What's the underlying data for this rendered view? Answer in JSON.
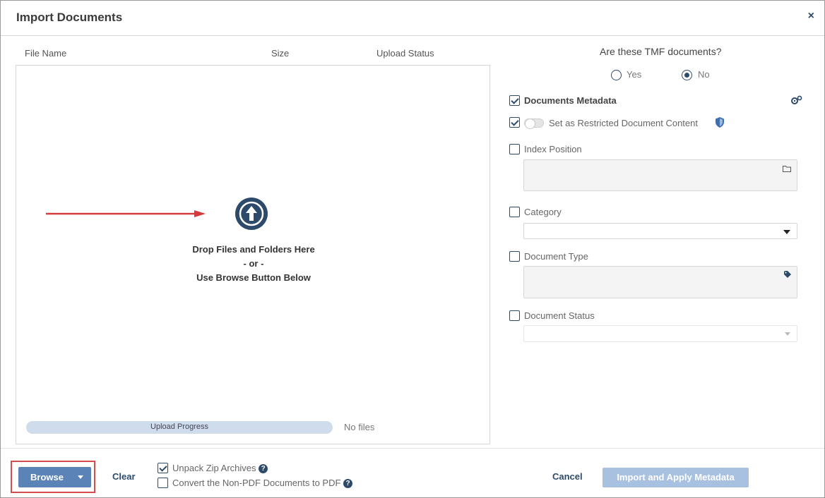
{
  "dialog": {
    "title": "Import Documents",
    "close_label": "×"
  },
  "file_table": {
    "columns": [
      "File Name",
      "Size",
      "Upload Status"
    ]
  },
  "dropzone": {
    "line1": "Drop Files and Folders Here",
    "line2": "- or -",
    "line3": "Use Browse Button Below",
    "upload_icon": "upload-arrow-circle",
    "pointer_arrow_color": "#d63a3a"
  },
  "progress": {
    "label": "Upload Progress",
    "value": 0,
    "status_text": "No files"
  },
  "tmf": {
    "question": "Are these TMF documents?",
    "options": [
      {
        "label": "Yes",
        "selected": false
      },
      {
        "label": "No",
        "selected": true
      }
    ]
  },
  "metadata": {
    "documents_metadata_label": "Documents Metadata",
    "documents_metadata_checked": true,
    "settings_icon": "gears-icon",
    "restricted_label": "Set as Restricted Document Content",
    "restricted_checked": true,
    "restricted_toggle_on": false,
    "shield_icon": "shield-icon",
    "index_position_label": "Index Position",
    "index_position_value": "",
    "folder_icon": "folder-icon",
    "category_label": "Category",
    "category_value": "",
    "document_type_label": "Document Type",
    "document_type_value": "",
    "tag_icon": "tag-icon",
    "document_status_label": "Document Status",
    "document_status_value": ""
  },
  "footer": {
    "browse_label": "Browse",
    "clear_label": "Clear",
    "unpack_zip_label": "Unpack Zip Archives",
    "unpack_zip_checked": true,
    "convert_pdf_label": "Convert the Non-PDF Documents to PDF",
    "convert_pdf_checked": false,
    "cancel_label": "Cancel",
    "import_label": "Import and Apply Metadata",
    "import_enabled": false
  },
  "colors": {
    "accent": "#2e4a6b",
    "button": "#5c83b7",
    "disabled_button": "#a9c1e0",
    "highlight_border": "#d44c4c"
  }
}
